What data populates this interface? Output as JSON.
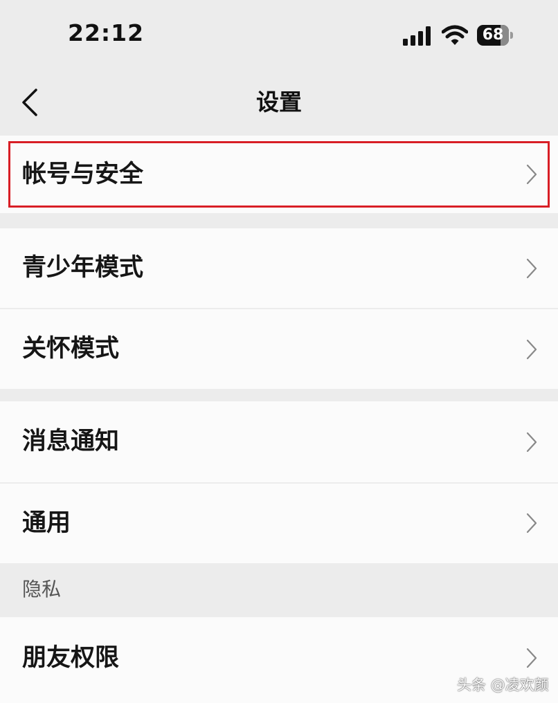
{
  "status_bar": {
    "time": "22:12",
    "battery_level": "68",
    "icons": [
      "signal-icon",
      "wifi-icon",
      "battery-icon"
    ]
  },
  "nav": {
    "title": "设置",
    "back_icon": "chevron-left-icon"
  },
  "groups": [
    {
      "items": [
        {
          "label": "帐号与安全",
          "highlighted": true
        }
      ]
    },
    {
      "items": [
        {
          "label": "青少年模式"
        },
        {
          "label": "关怀模式"
        }
      ]
    },
    {
      "items": [
        {
          "label": "消息通知"
        },
        {
          "label": "通用"
        }
      ]
    },
    {
      "header": "隐私",
      "items": [
        {
          "label": "朋友权限"
        }
      ]
    }
  ],
  "colors": {
    "highlight": "#d81e25",
    "row_background": "#fbfbfb",
    "page_background": "#ececec"
  },
  "watermark": "头条 @凌欢颜"
}
